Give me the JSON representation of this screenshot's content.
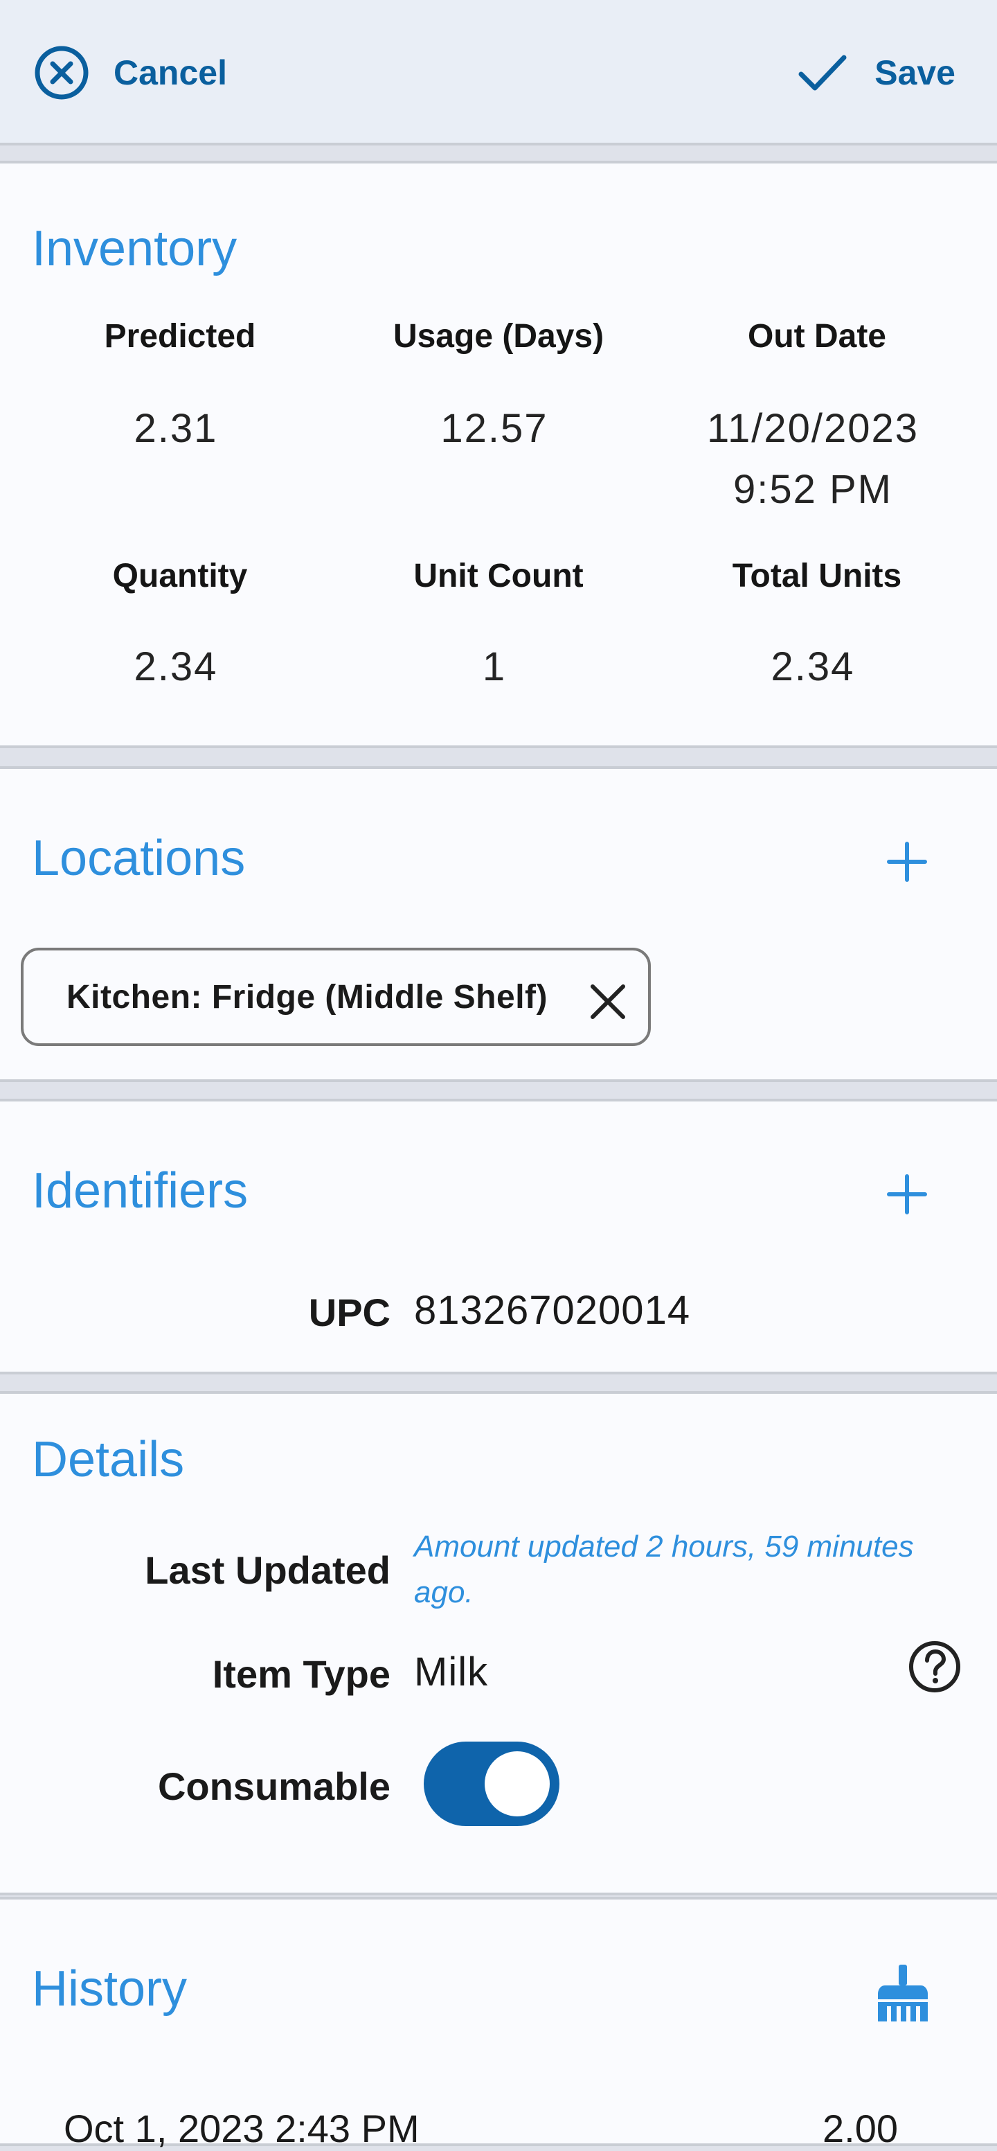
{
  "topbar": {
    "cancel_label": "Cancel",
    "save_label": "Save"
  },
  "inventory": {
    "title": "Inventory",
    "headers_row1": [
      "Predicted",
      "Usage (Days)",
      "Out Date"
    ],
    "values_row1": [
      "2.31",
      "12.57",
      "11/20/2023"
    ],
    "out_date_time": "9:52 PM",
    "headers_row2": [
      "Quantity",
      "Unit Count",
      "Total Units"
    ],
    "values_row2": [
      "2.34",
      "1",
      "2.34"
    ]
  },
  "locations": {
    "title": "Locations",
    "chips": [
      "Kitchen: Fridge (Middle Shelf)"
    ]
  },
  "identifiers": {
    "title": "Identifiers",
    "type": "UPC",
    "value": "813267020014"
  },
  "details": {
    "title": "Details",
    "last_updated_label": "Last Updated",
    "last_updated_value": "Amount updated 2 hours, 59 minutes ago.",
    "item_type_label": "Item Type",
    "item_type_value": "Milk",
    "consumable_label": "Consumable",
    "consumable_on": true
  },
  "history": {
    "title": "History",
    "first_entry_date": "Oct 1, 2023 2:43 PM",
    "first_entry_amount": "2.00"
  },
  "colors": {
    "accent": "#2e8fdd",
    "primary": "#0f64ab",
    "header_bg": "#e9eef6"
  }
}
